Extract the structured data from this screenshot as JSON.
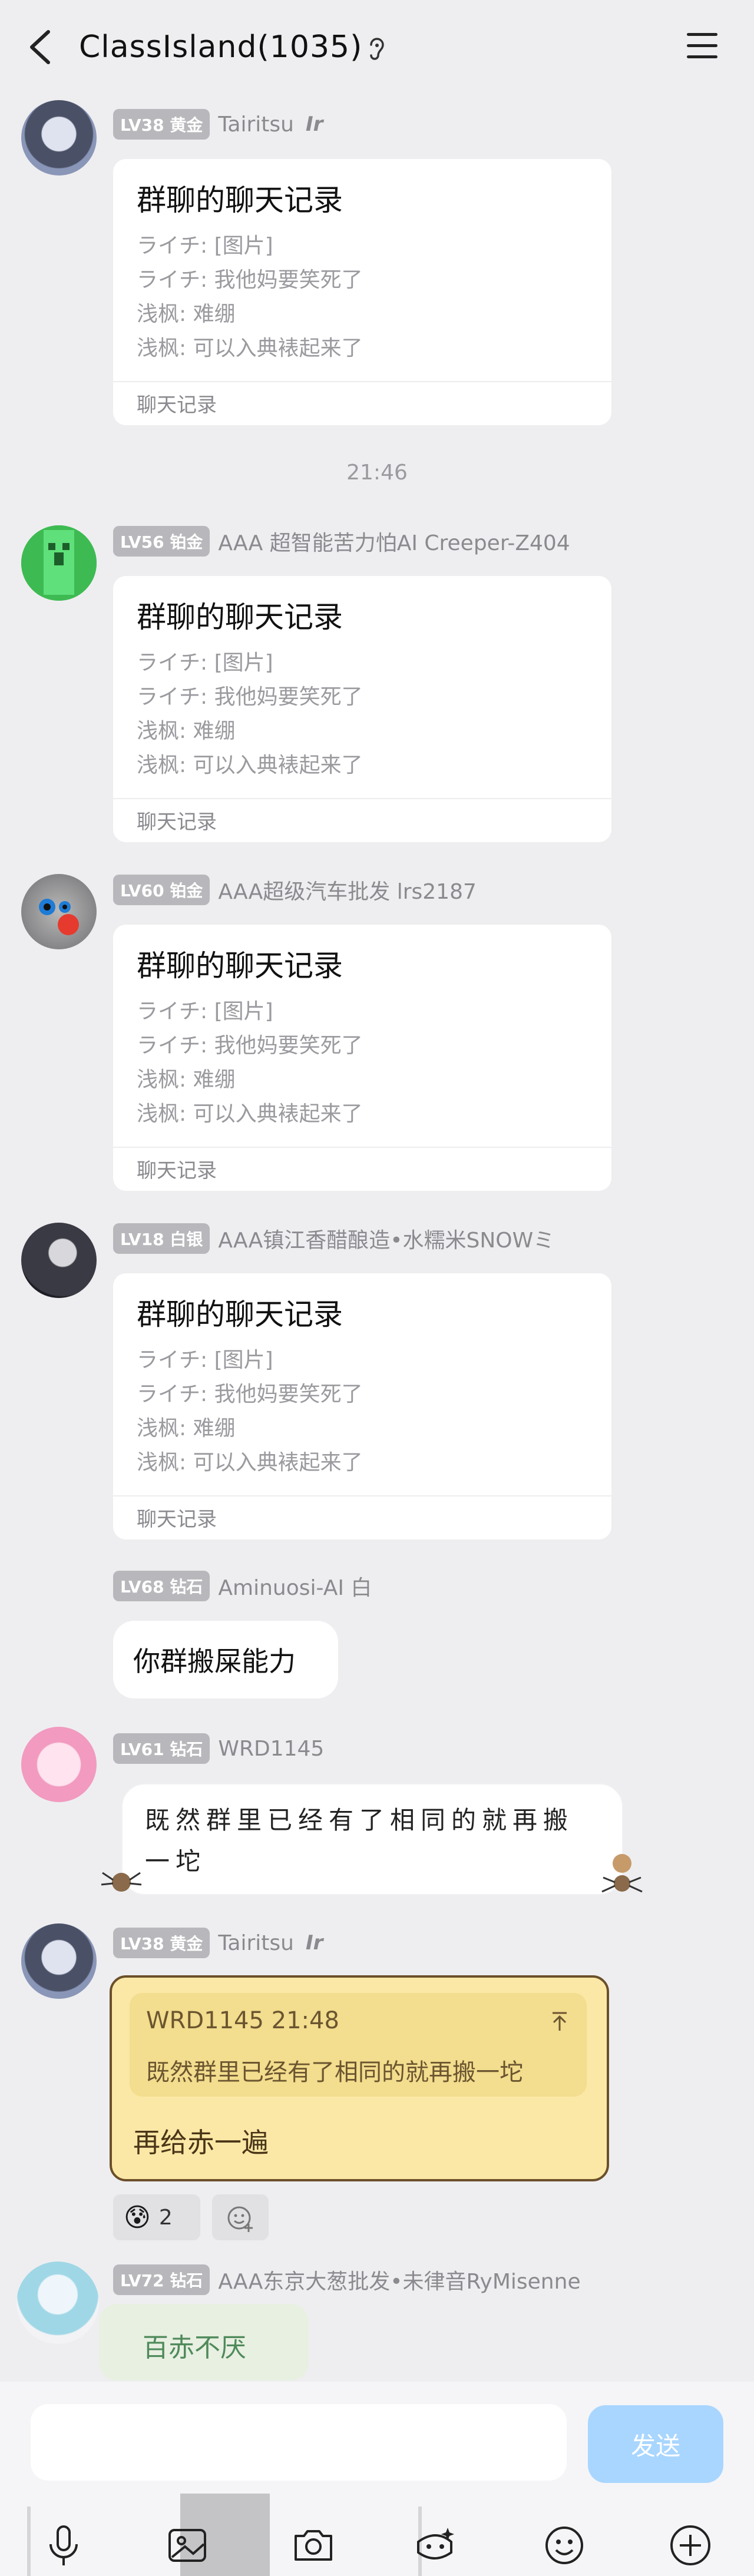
{
  "header": {
    "title": "ClassIsland(1035)"
  },
  "messages": [
    {
      "level": "LV38 黄金",
      "nick": "Tairitsu",
      "suffix": "Ir",
      "card": {
        "title": "群聊的聊天记录",
        "lines": [
          "ライチ: [图片]",
          "ライチ: 我他妈要笑死了",
          "浅枫: 难绷",
          "浅枫: 可以入典裱起来了"
        ],
        "footer": "聊天记录"
      }
    },
    {
      "level": "LV56 铂金",
      "nick": "AAA 超智能苦力怕AI Creeper-Z404",
      "card": {
        "title": "群聊的聊天记录",
        "lines": [
          "ライチ: [图片]",
          "ライチ: 我他妈要笑死了",
          "浅枫: 难绷",
          "浅枫: 可以入典裱起来了"
        ],
        "footer": "聊天记录"
      }
    },
    {
      "level": "LV60 铂金",
      "nick": "AAA超级汽车批发 lrs2187",
      "card": {
        "title": "群聊的聊天记录",
        "lines": [
          "ライチ: [图片]",
          "ライチ: 我他妈要笑死了",
          "浅枫: 难绷",
          "浅枫: 可以入典裱起来了"
        ],
        "footer": "聊天记录"
      }
    },
    {
      "level": "LV18 白银",
      "nick": "AAA镇江香醋酿造•水糯米SNOWミ",
      "card": {
        "title": "群聊的聊天记录",
        "lines": [
          "ライチ: [图片]",
          "ライチ: 我他妈要笑死了",
          "浅枫: 难绷",
          "浅枫: 可以入典裱起来了"
        ],
        "footer": "聊天记录"
      }
    },
    {
      "level": "LV68 钻石",
      "nick": "Aminuosi-AI 白",
      "text": "你群搬屎能力"
    },
    {
      "level": "LV61 钻石",
      "nick": "WRD1145",
      "text": "既然群里已经有了相同的就再搬一坨"
    },
    {
      "level": "LV38 黄金",
      "nick": "Tairitsu",
      "suffix": "Ir",
      "quote": {
        "head": "WRD1145 21:48",
        "body": "既然群里已经有了相同的就再搬一坨"
      },
      "text": "再给赤一遍",
      "reaction_count": "2"
    },
    {
      "level": "LV72 钻石",
      "nick": "AAA东京大葱批发•未律音RyMisenne",
      "sticker_text": "百赤不厌"
    }
  ],
  "timestamp": "21:46",
  "composer": {
    "send_label": "发送"
  },
  "colors": {
    "send": "#a9d6ff",
    "accent": "#fbe8a6",
    "badge": "#b8b8bc"
  }
}
